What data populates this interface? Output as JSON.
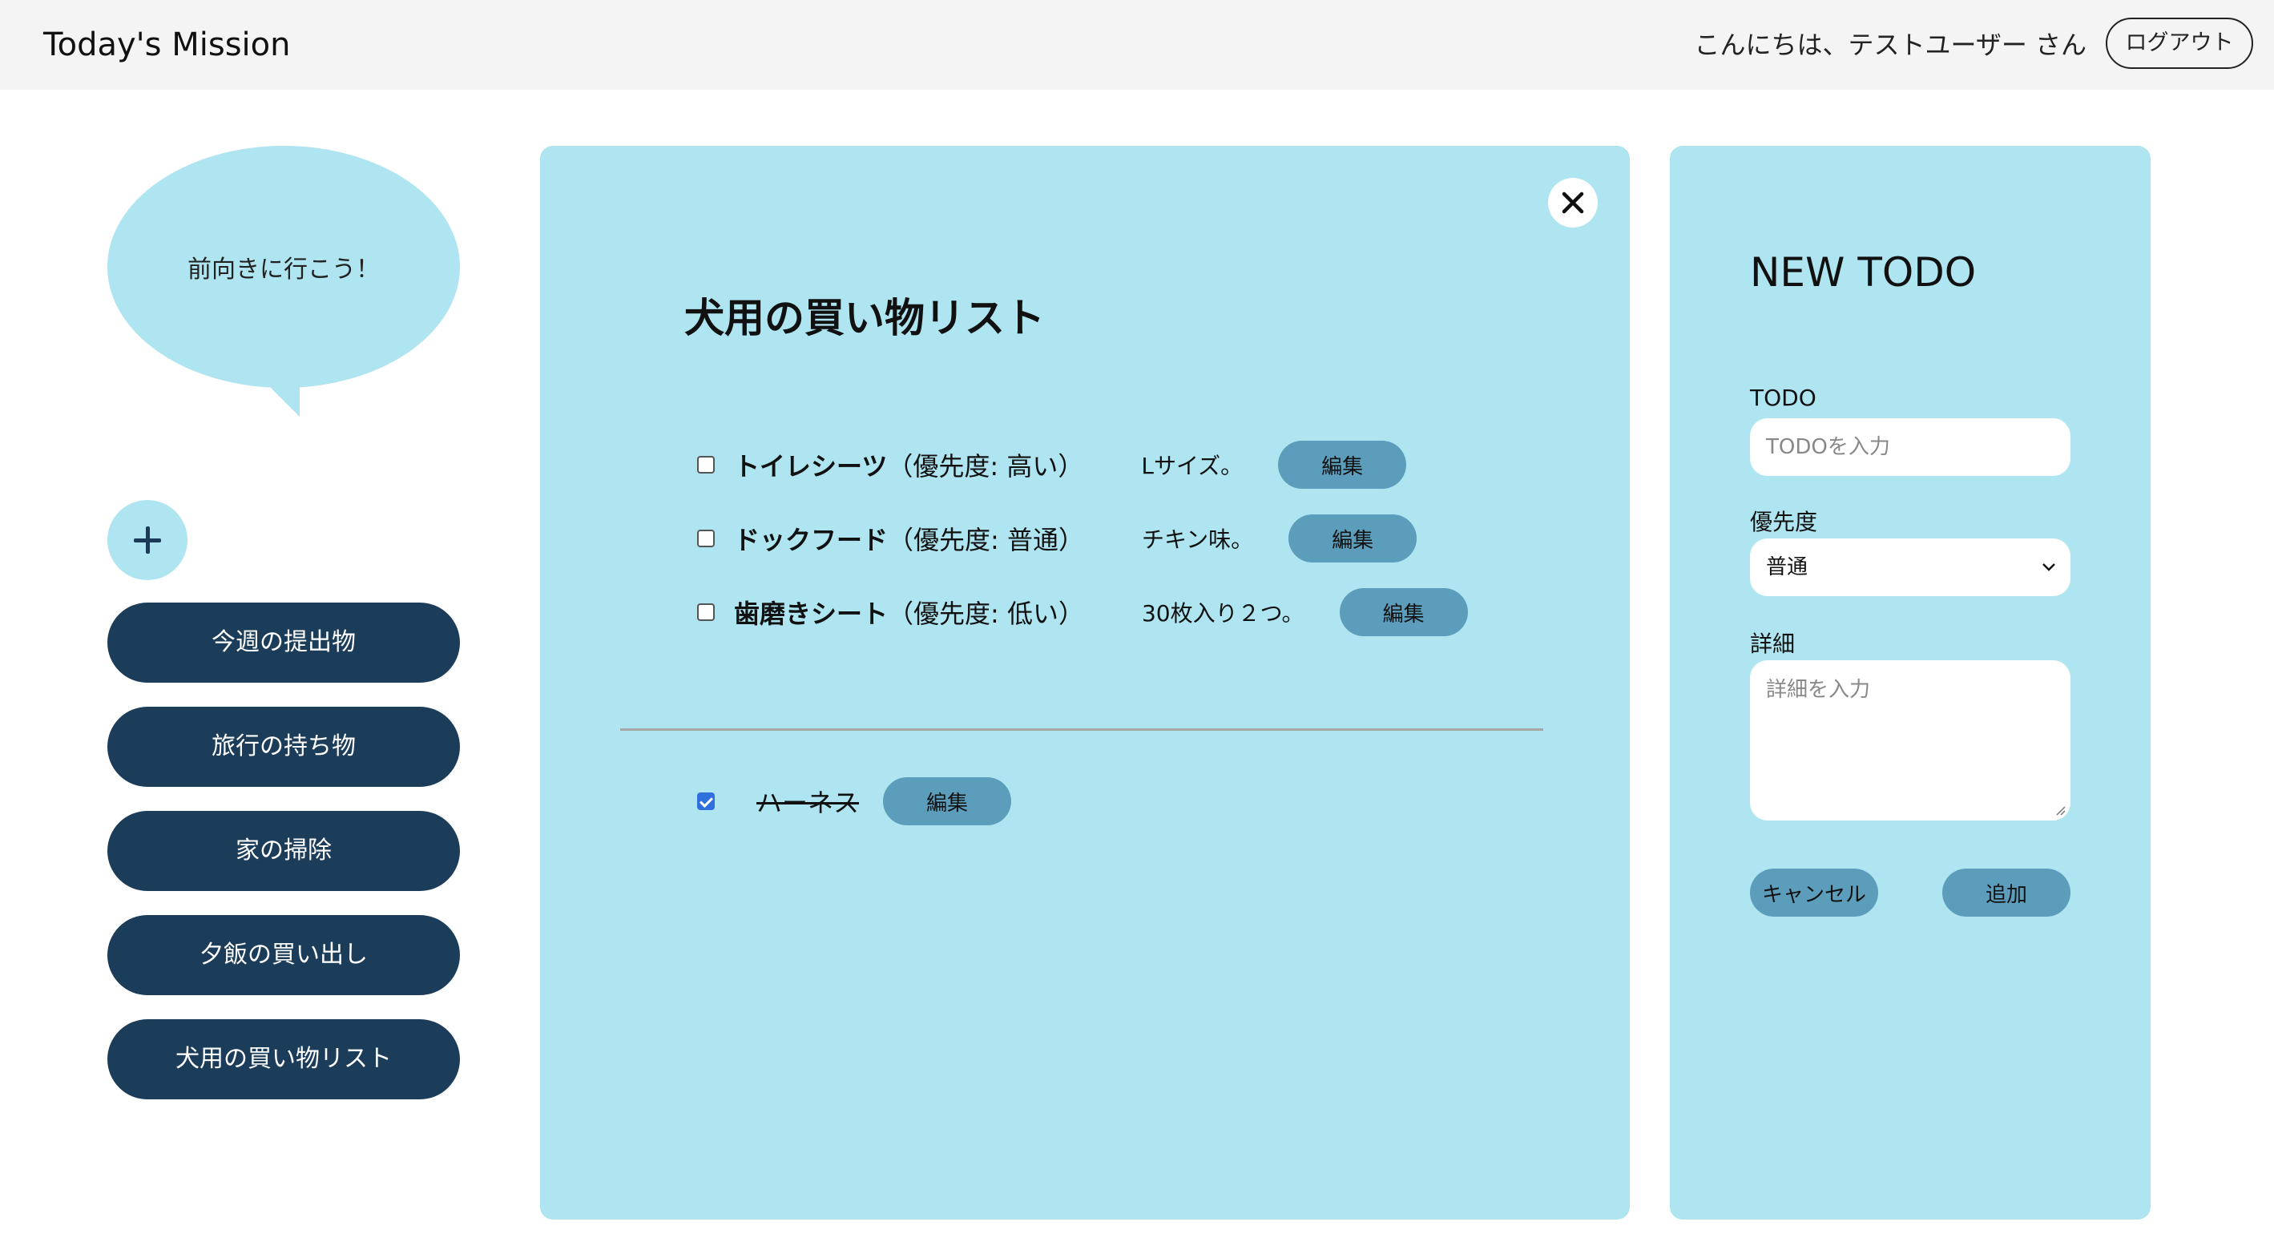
{
  "header": {
    "app_title": "Today's Mission",
    "greeting": "こんにちは、テストユーザー さん",
    "logout_label": "ログアウト"
  },
  "sidebar": {
    "bubble_text": "前向きに行こう！",
    "add_icon": "plus-icon",
    "lists": [
      {
        "label": "今週の提出物"
      },
      {
        "label": "旅行の持ち物"
      },
      {
        "label": "家の掃除"
      },
      {
        "label": "夕飯の買い出し"
      },
      {
        "label": "犬用の買い物リスト"
      }
    ]
  },
  "list_view": {
    "title": "犬用の買い物リスト",
    "close_icon": "close-icon",
    "todos": [
      {
        "title": "トイレシーツ",
        "priority": "（優先度: 高い）",
        "detail": "Lサイズ。",
        "edit_label": "編集",
        "checked": false
      },
      {
        "title": "ドックフード",
        "priority": "（優先度: 普通）",
        "detail": "チキン味。",
        "edit_label": "編集",
        "checked": false
      },
      {
        "title": "歯磨きシート",
        "priority": "（優先度: 低い）",
        "detail": "30枚入り２つ。",
        "edit_label": "編集",
        "checked": false
      }
    ],
    "completed": [
      {
        "title": "ハーネス",
        "edit_label": "編集",
        "checked": true
      }
    ]
  },
  "new_todo_form": {
    "title": "NEW TODO",
    "todo_label": "TODO",
    "todo_placeholder": "TODOを入力",
    "priority_label": "優先度",
    "priority_selected": "普通",
    "detail_label": "詳細",
    "detail_placeholder": "詳細を入力",
    "cancel_label": "キャンセル",
    "add_label": "追加"
  },
  "colors": {
    "header_bg": "#f4f4f4",
    "panel_bg": "#aee5f1",
    "list_button_bg": "#1c3d5a",
    "action_button_bg": "#5b9dbb",
    "checkbox_checked": "#2f6fde"
  }
}
